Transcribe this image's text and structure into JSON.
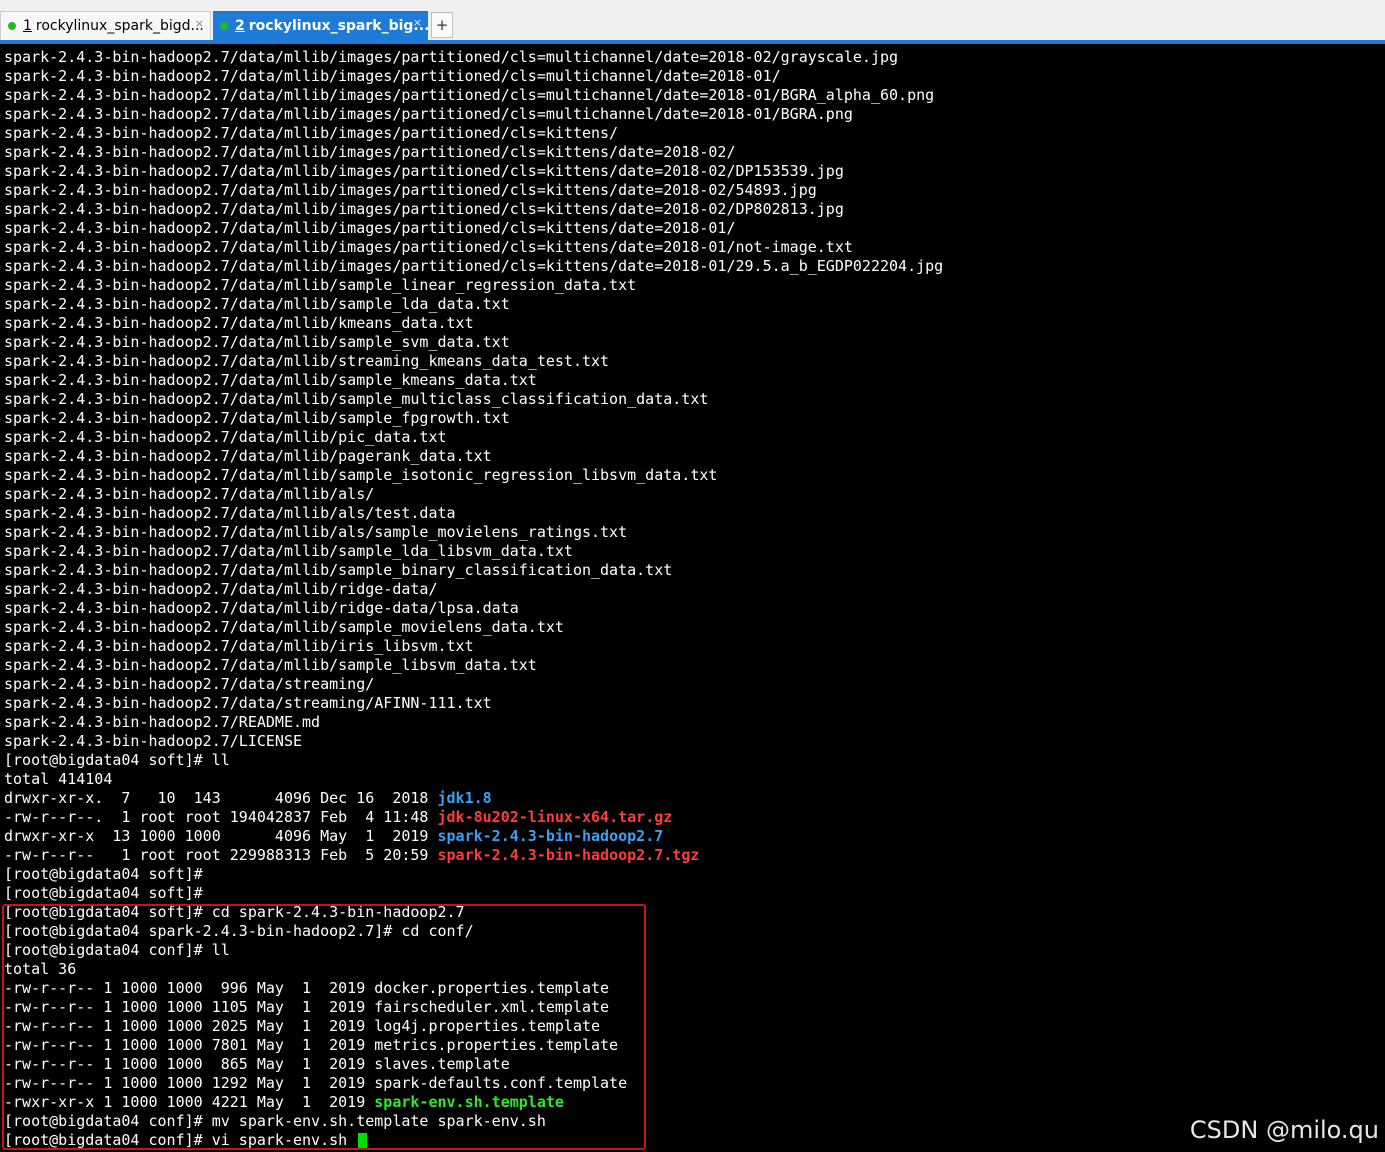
{
  "tabs": [
    {
      "num": "1",
      "label": "rockylinux_spark_bigd...",
      "close": "×",
      "active": false
    },
    {
      "num": "2",
      "label": "rockylinux_spark_big...",
      "close": "×",
      "active": true
    }
  ],
  "new_tab_label": "+",
  "colors": {
    "accent": "#1f7bd8",
    "dir": "#3aa0f5",
    "archive": "#ff3b3b",
    "executable": "#2ee82e",
    "cursor": "#00e000",
    "highlight_border": "#c01818"
  },
  "terminal": {
    "lines": [
      {
        "text": "spark-2.4.3-bin-hadoop2.7/data/mllib/images/partitioned/cls=multichannel/date=2018-02/grayscale.jpg"
      },
      {
        "text": "spark-2.4.3-bin-hadoop2.7/data/mllib/images/partitioned/cls=multichannel/date=2018-01/"
      },
      {
        "text": "spark-2.4.3-bin-hadoop2.7/data/mllib/images/partitioned/cls=multichannel/date=2018-01/BGRA_alpha_60.png"
      },
      {
        "text": "spark-2.4.3-bin-hadoop2.7/data/mllib/images/partitioned/cls=multichannel/date=2018-01/BGRA.png"
      },
      {
        "text": "spark-2.4.3-bin-hadoop2.7/data/mllib/images/partitioned/cls=kittens/"
      },
      {
        "text": "spark-2.4.3-bin-hadoop2.7/data/mllib/images/partitioned/cls=kittens/date=2018-02/"
      },
      {
        "text": "spark-2.4.3-bin-hadoop2.7/data/mllib/images/partitioned/cls=kittens/date=2018-02/DP153539.jpg"
      },
      {
        "text": "spark-2.4.3-bin-hadoop2.7/data/mllib/images/partitioned/cls=kittens/date=2018-02/54893.jpg"
      },
      {
        "text": "spark-2.4.3-bin-hadoop2.7/data/mllib/images/partitioned/cls=kittens/date=2018-02/DP802813.jpg"
      },
      {
        "text": "spark-2.4.3-bin-hadoop2.7/data/mllib/images/partitioned/cls=kittens/date=2018-01/"
      },
      {
        "text": "spark-2.4.3-bin-hadoop2.7/data/mllib/images/partitioned/cls=kittens/date=2018-01/not-image.txt"
      },
      {
        "text": "spark-2.4.3-bin-hadoop2.7/data/mllib/images/partitioned/cls=kittens/date=2018-01/29.5.a_b_EGDP022204.jpg"
      },
      {
        "text": "spark-2.4.3-bin-hadoop2.7/data/mllib/sample_linear_regression_data.txt"
      },
      {
        "text": "spark-2.4.3-bin-hadoop2.7/data/mllib/sample_lda_data.txt"
      },
      {
        "text": "spark-2.4.3-bin-hadoop2.7/data/mllib/kmeans_data.txt"
      },
      {
        "text": "spark-2.4.3-bin-hadoop2.7/data/mllib/sample_svm_data.txt"
      },
      {
        "text": "spark-2.4.3-bin-hadoop2.7/data/mllib/streaming_kmeans_data_test.txt"
      },
      {
        "text": "spark-2.4.3-bin-hadoop2.7/data/mllib/sample_kmeans_data.txt"
      },
      {
        "text": "spark-2.4.3-bin-hadoop2.7/data/mllib/sample_multiclass_classification_data.txt"
      },
      {
        "text": "spark-2.4.3-bin-hadoop2.7/data/mllib/sample_fpgrowth.txt"
      },
      {
        "text": "spark-2.4.3-bin-hadoop2.7/data/mllib/pic_data.txt"
      },
      {
        "text": "spark-2.4.3-bin-hadoop2.7/data/mllib/pagerank_data.txt"
      },
      {
        "text": "spark-2.4.3-bin-hadoop2.7/data/mllib/sample_isotonic_regression_libsvm_data.txt"
      },
      {
        "text": "spark-2.4.3-bin-hadoop2.7/data/mllib/als/"
      },
      {
        "text": "spark-2.4.3-bin-hadoop2.7/data/mllib/als/test.data"
      },
      {
        "text": "spark-2.4.3-bin-hadoop2.7/data/mllib/als/sample_movielens_ratings.txt"
      },
      {
        "text": "spark-2.4.3-bin-hadoop2.7/data/mllib/sample_lda_libsvm_data.txt"
      },
      {
        "text": "spark-2.4.3-bin-hadoop2.7/data/mllib/sample_binary_classification_data.txt"
      },
      {
        "text": "spark-2.4.3-bin-hadoop2.7/data/mllib/ridge-data/"
      },
      {
        "text": "spark-2.4.3-bin-hadoop2.7/data/mllib/ridge-data/lpsa.data"
      },
      {
        "text": "spark-2.4.3-bin-hadoop2.7/data/mllib/sample_movielens_data.txt"
      },
      {
        "text": "spark-2.4.3-bin-hadoop2.7/data/mllib/iris_libsvm.txt"
      },
      {
        "text": "spark-2.4.3-bin-hadoop2.7/data/mllib/sample_libsvm_data.txt"
      },
      {
        "text": "spark-2.4.3-bin-hadoop2.7/data/streaming/"
      },
      {
        "text": "spark-2.4.3-bin-hadoop2.7/data/streaming/AFINN-111.txt"
      },
      {
        "text": "spark-2.4.3-bin-hadoop2.7/README.md"
      },
      {
        "text": "spark-2.4.3-bin-hadoop2.7/LICENSE"
      },
      {
        "text": "[root@bigdata04 soft]# ll"
      },
      {
        "text": "total 414104"
      },
      {
        "text": "drwxr-xr-x.  7   10  143      4096 Dec 16  2018 ",
        "colored": "jdk1.8",
        "kind": "dir"
      },
      {
        "text": "-rw-r--r--.  1 root root 194042837 Feb  4 11:48 ",
        "colored": "jdk-8u202-linux-x64.tar.gz",
        "kind": "arc"
      },
      {
        "text": "drwxr-xr-x  13 1000 1000      4096 May  1  2019 ",
        "colored": "spark-2.4.3-bin-hadoop2.7",
        "kind": "dir"
      },
      {
        "text": "-rw-r--r--   1 root root 229988313 Feb  5 20:59 ",
        "colored": "spark-2.4.3-bin-hadoop2.7.tgz",
        "kind": "arc"
      },
      {
        "text": "[root@bigdata04 soft]#"
      },
      {
        "text": "[root@bigdata04 soft]#"
      },
      {
        "text": "[root@bigdata04 soft]# cd spark-2.4.3-bin-hadoop2.7"
      },
      {
        "text": "[root@bigdata04 spark-2.4.3-bin-hadoop2.7]# cd conf/"
      },
      {
        "text": "[root@bigdata04 conf]# ll"
      },
      {
        "text": "total 36"
      },
      {
        "text": "-rw-r--r-- 1 1000 1000  996 May  1  2019 docker.properties.template"
      },
      {
        "text": "-rw-r--r-- 1 1000 1000 1105 May  1  2019 fairscheduler.xml.template"
      },
      {
        "text": "-rw-r--r-- 1 1000 1000 2025 May  1  2019 log4j.properties.template"
      },
      {
        "text": "-rw-r--r-- 1 1000 1000 7801 May  1  2019 metrics.properties.template"
      },
      {
        "text": "-rw-r--r-- 1 1000 1000  865 May  1  2019 slaves.template"
      },
      {
        "text": "-rw-r--r-- 1 1000 1000 1292 May  1  2019 spark-defaults.conf.template"
      },
      {
        "text": "-rwxr-xr-x 1 1000 1000 4221 May  1  2019 ",
        "colored": "spark-env.sh.template",
        "kind": "exe"
      },
      {
        "text": "[root@bigdata04 conf]# mv spark-env.sh.template spark-env.sh"
      },
      {
        "text": "[root@bigdata04 conf]# vi spark-env.sh ",
        "cursor": true
      }
    ]
  },
  "watermark": "CSDN @milo.qu"
}
